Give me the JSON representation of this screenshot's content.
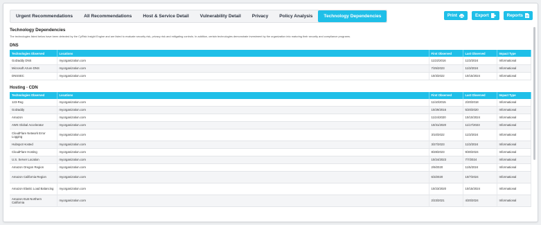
{
  "tabs": [
    {
      "label": "Urgent Recommendations"
    },
    {
      "label": "All Recommendations"
    },
    {
      "label": "Host & Service Detail"
    },
    {
      "label": "Vulnerability Detail"
    },
    {
      "label": "Privacy"
    },
    {
      "label": "Policy Analysis"
    },
    {
      "label": "Technology Dependencies"
    }
  ],
  "active_tab": "Technology Dependencies",
  "actions": {
    "print": "Print",
    "export": "Export",
    "reports": "Reports"
  },
  "colors": {
    "accent": "#1fbfe8"
  },
  "page": {
    "title": "Technology Dependencies",
    "description": "The technologies listed below have been detected by the CyRisk Insight Engine and are listed to evaluate security risk, privacy risk and mitigating controls. In addition, certain technologies demonstrate investment by the organization into maturing their security and compliance programs."
  },
  "columns": [
    "Technologies Observed",
    "Locations",
    "First Observed",
    "Last Observed",
    "Impact Type"
  ],
  "sections": [
    {
      "title": "DNS",
      "rows": [
        [
          "GoDaddy DNS",
          "myorganization.com",
          "11/22/2016",
          "11/3/2024",
          "Informational"
        ],
        [
          "Microsoft Azure DNS",
          "myorganization.com",
          "7/25/2023",
          "11/3/2024",
          "Informational"
        ],
        [
          "DNSSEC",
          "myorganization.com",
          "10/3/2022",
          "10/15/2024",
          "Informational"
        ]
      ]
    },
    {
      "title": "Hosting - CDN",
      "rows": [
        [
          "123-Reg",
          "myorganization.com",
          "11/10/2015",
          "2/20/2018",
          "Informational"
        ],
        [
          "GoDaddy",
          "myorganization.com",
          "10/29/2016",
          "5/20/2020",
          "Informational"
        ],
        [
          "Amazon",
          "myorganization.com",
          "11/24/2020",
          "10/10/2024",
          "Informational"
        ],
        [
          "AWS Global Accelerator",
          "myorganization.com",
          "10/31/2020",
          "11/17/2023",
          "Informational"
        ],
        [
          "CloudFlare Network Error Logging",
          "myorganization.com",
          "3/10/2022",
          "11/3/2024",
          "Informational"
        ],
        [
          "Hubspot Hosted",
          "myorganization.com",
          "3/27/2023",
          "11/3/2024",
          "Informational"
        ],
        [
          "CloudFlare Hosting",
          "myorganization.com",
          "8/28/2023",
          "9/30/2024",
          "Informational"
        ],
        [
          "U.S. Server Location",
          "myorganization.com",
          "10/24/2023",
          "7/7/2024",
          "Informational"
        ],
        [
          "Amazon Oregon Region",
          "myorganization.com",
          "2/9/2020",
          "11/5/2024",
          "Informational"
        ],
        [
          "Amazon California Region",
          "myorganization.com",
          "6/3/2020",
          "10/7/2024",
          "Informational"
        ],
        [
          "Amazon Elastic Load Balancing",
          "myorganization.com",
          "10/23/2020",
          "10/15/2024",
          "Informational"
        ],
        [
          "Amazon ELB Northern California",
          "myorganization.com",
          "2/23/2021",
          "4/20/2024",
          "Informational"
        ]
      ]
    }
  ]
}
